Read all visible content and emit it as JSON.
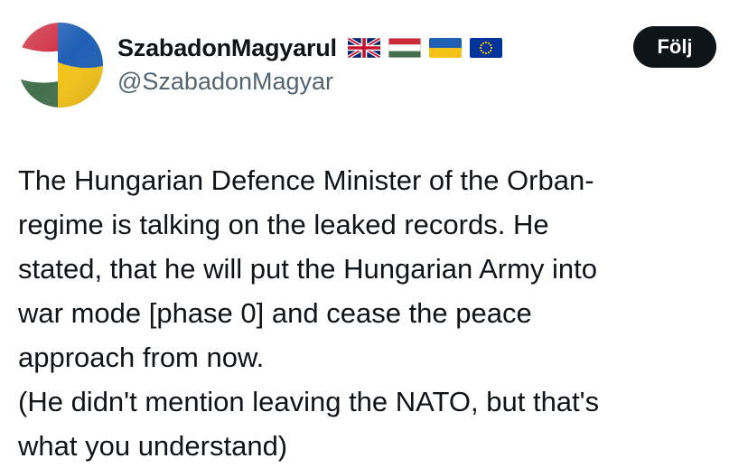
{
  "author": {
    "display_name": "SzabadonMagyarul",
    "handle": "@SzabadonMagyar",
    "flags": [
      "uk-flag-icon",
      "hungary-flag-icon",
      "ukraine-flag-icon",
      "eu-flag-icon"
    ]
  },
  "actions": {
    "follow_label": "Följ"
  },
  "tweet": {
    "lines": [
      "The Hungarian Defence Minister of the Orban-",
      "regime is talking on the leaked records. He",
      "stated, that he will put the Hungarian Army into",
      "war mode [phase 0] and cease the peace",
      "approach from now.",
      "(He didn't mention leaving the NATO, but that's",
      "what you understand)"
    ]
  },
  "colors": {
    "text_primary": "#0f1419",
    "text_secondary": "#536471",
    "button_bg": "#0f1419",
    "button_text": "#ffffff"
  }
}
